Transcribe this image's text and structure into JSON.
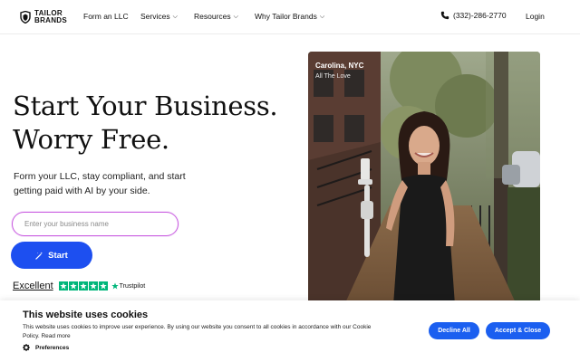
{
  "nav": {
    "logo_line1": "TAILOR",
    "logo_line2": "BRANDS",
    "links": [
      {
        "label": "Form an LLC"
      },
      {
        "label": "Services",
        "chevron": "⌵"
      },
      {
        "label": "Resources",
        "chevron": "⌵"
      },
      {
        "label": "Why Tailor Brands",
        "chevron": "⌵"
      }
    ],
    "phone": "(332)-286-2770",
    "login": "Login"
  },
  "hero": {
    "headline_line1": "Start Your Business.",
    "headline_line2": "Worry Free.",
    "subtext": "Form your LLC, stay compliant, and start getting paid with AI by your side.",
    "input_placeholder": "Enter your business name",
    "input_value": "",
    "start_label": "Start",
    "rating_label": "Excellent",
    "stars": 5,
    "trustpilot": "Trustpilot"
  },
  "photo": {
    "name": "Carolina, NYC",
    "subtitle": "All The Love"
  },
  "cookie_banner": {
    "title": "This website uses cookies",
    "text": "This website uses cookies to improve user experience. By using our website you consent to all cookies in accordance with our Cookie Policy.",
    "read_more": "Read more",
    "preferences": "Preferences",
    "decline_label": "Decline All",
    "accept_label": "Accept & Close"
  },
  "colors": {
    "primary_button": "#1d4ff0",
    "cookie_button": "#1b5ff0",
    "trustpilot_green": "#00b67a",
    "input_border": "#c95ce0"
  },
  "icons": {
    "logo": "tailor-brands-shield-icon",
    "phone": "phone-icon",
    "start": "magic-wand-icon",
    "star": "star-icon",
    "preferences": "gear-icon"
  }
}
